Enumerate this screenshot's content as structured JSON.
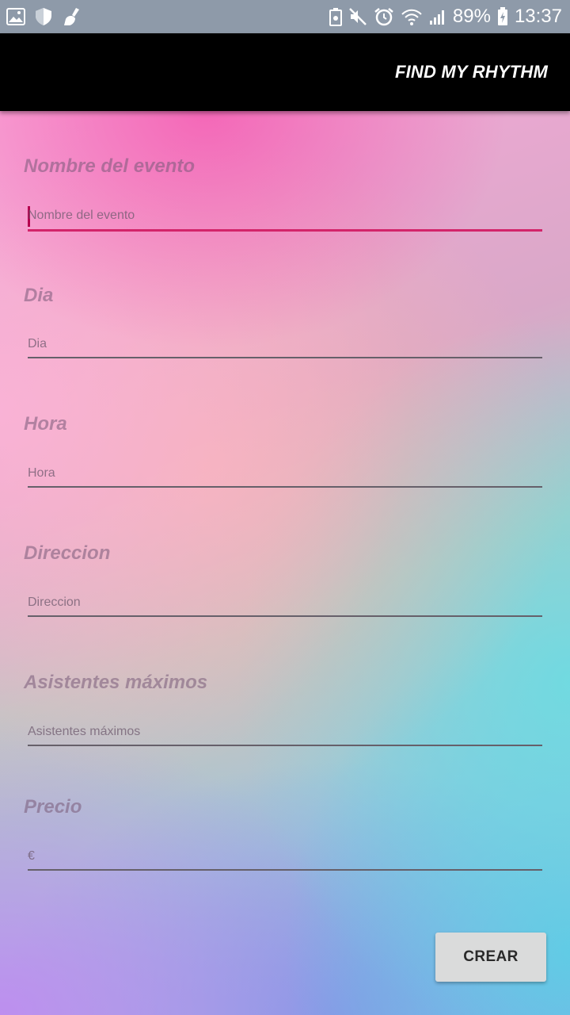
{
  "status_bar": {
    "battery": "89%",
    "time": "13:37",
    "left_icons": [
      "image-icon",
      "shield-icon",
      "broom-icon"
    ],
    "right_icons": [
      "battery-saver-icon",
      "mute-icon",
      "alarm-icon",
      "wifi-icon",
      "signal-icon",
      "battery-charging-icon"
    ]
  },
  "app_bar": {
    "title": "FIND MY RHYTHM",
    "background": "#000000"
  },
  "form": {
    "fields": [
      {
        "title": "Nombre del evento",
        "placeholder": "Nombre del evento",
        "focused": true
      },
      {
        "title": "Dia",
        "placeholder": "Dia",
        "focused": false
      },
      {
        "title": "Hora",
        "placeholder": "Hora",
        "focused": false
      },
      {
        "title": "Direccion",
        "placeholder": "Direccion",
        "focused": false
      },
      {
        "title": "Asistentes máximos",
        "placeholder": "Asistentes máximos",
        "focused": false
      },
      {
        "title": "Precio",
        "placeholder": "€",
        "focused": false
      }
    ],
    "submit_label": "CREAR"
  },
  "colors": {
    "accent": "#d3246a",
    "status_bar": "#8e9aa9",
    "button": "#dadbdb"
  }
}
